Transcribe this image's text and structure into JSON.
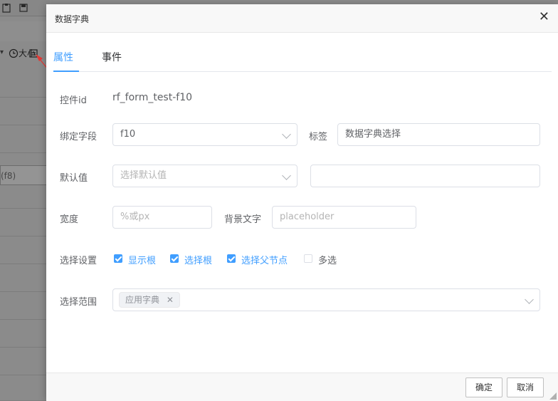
{
  "background": {
    "toolbar_size_label": "大小",
    "field_partial": "(f8)"
  },
  "dialog": {
    "title": "数据字典",
    "close_glyph": "✕"
  },
  "tabs": [
    {
      "label": "属性",
      "active": true
    },
    {
      "label": "事件",
      "active": false
    }
  ],
  "form": {
    "control_id_label": "控件id",
    "control_id_value": "rf_form_test-f10",
    "bind_field_label": "绑定字段",
    "bind_field_value": "f10",
    "tag_label": "标签",
    "tag_value": "数据字典选择",
    "default_label": "默认值",
    "default_placeholder": "选择默认值",
    "default_text_value": "",
    "width_label": "宽度",
    "width_placeholder": "%或px",
    "bg_text_label": "背景文字",
    "bg_text_placeholder": "placeholder",
    "select_settings_label": "选择设置",
    "checkboxes": [
      {
        "label": "显示根",
        "checked": true
      },
      {
        "label": "选择根",
        "checked": true
      },
      {
        "label": "选择父节点",
        "checked": true
      },
      {
        "label": "多选",
        "checked": false
      }
    ],
    "range_label": "选择范围",
    "range_tags": [
      {
        "label": "应用字典",
        "remove_glyph": "✕"
      }
    ]
  },
  "footer": {
    "confirm_label": "确定",
    "cancel_label": "取消"
  },
  "colors": {
    "accent": "#409eff",
    "annotation_arrow": "#e53935"
  }
}
